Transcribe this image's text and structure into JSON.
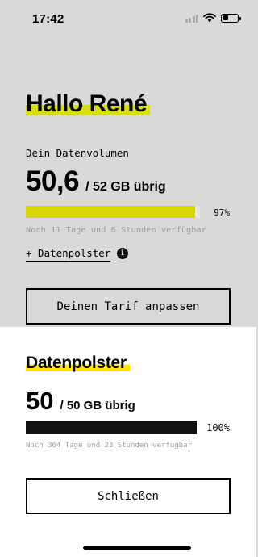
{
  "status_bar": {
    "time": "17:42"
  },
  "main": {
    "greeting": "Hallo René",
    "volume_label": "Dein Datenvolumen",
    "remaining": "50,6",
    "remaining_rest": "/ 52 GB übrig",
    "percent_label": "97%",
    "percent_value": 97,
    "availability": "Noch 11 Tage und 6 Stunden verfügbar",
    "polster_link": "+ Datenpolster",
    "info_glyph": "i",
    "tarif_button": "Deinen Tarif anpassen"
  },
  "sheet": {
    "title": "Datenpolster",
    "remaining": "50",
    "remaining_rest": "/ 50 GB übrig",
    "percent_label": "100%",
    "percent_value": 100,
    "availability": "Noch 364 Tage und 23 Stunden verfügbar",
    "close_button": "Schließen"
  },
  "colors": {
    "accent_yellow": "#d8e000",
    "dim_overlay": "#d9d9d9",
    "sheet_bg": "#ffffff"
  }
}
